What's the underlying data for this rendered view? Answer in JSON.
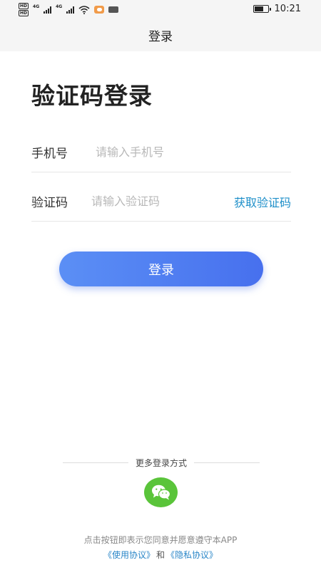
{
  "status_bar": {
    "hd_badges": [
      "HD",
      "HD"
    ],
    "network_labels": [
      "4G",
      "4G"
    ],
    "time": "10:21",
    "battery_level": 0.7
  },
  "nav": {
    "title": "登录"
  },
  "page": {
    "title": "验证码登录"
  },
  "form": {
    "phone": {
      "label": "手机号",
      "placeholder": "请输入手机号",
      "value": ""
    },
    "code": {
      "label": "验证码",
      "placeholder": "请输入验证码",
      "value": "",
      "get_code_label": "获取验证码"
    },
    "submit_label": "登录"
  },
  "more_login": {
    "label": "更多登录方式",
    "options": [
      {
        "icon": "wechat-icon"
      }
    ]
  },
  "agreement": {
    "text": "点击按钮即表示您同意并愿意遵守本APP",
    "terms_link": "《使用协议》",
    "and": "和",
    "privacy_link": "《隐私协议》"
  },
  "colors": {
    "accent": "#4a77ef",
    "link": "#2a86c8",
    "wechat": "#5ac43a",
    "get_code": "#1e8fc9"
  }
}
